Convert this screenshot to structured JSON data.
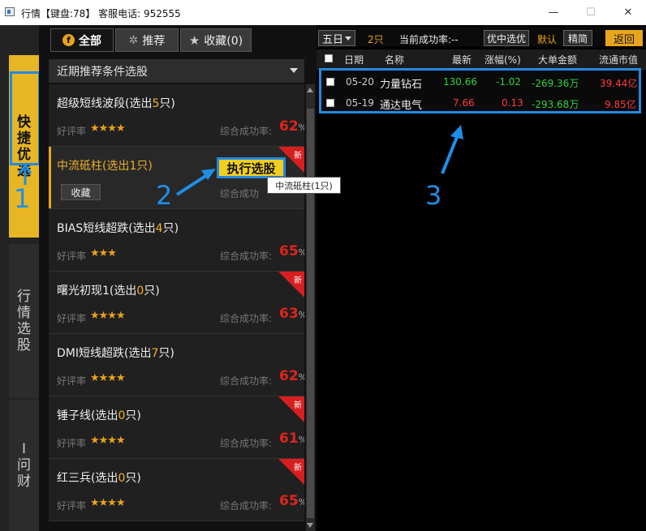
{
  "window": {
    "title": "行情【键盘:78】 客服电话: 952555",
    "min": "—",
    "max": "☐",
    "close": "✕"
  },
  "sidebar": {
    "tabs": [
      {
        "label": [
          "快",
          "捷",
          "优",
          "选"
        ],
        "active": true
      },
      {
        "label": [
          "行",
          "情",
          "选",
          "股"
        ],
        "active": false
      },
      {
        "label": [
          "I",
          "问",
          "财"
        ],
        "active": false
      }
    ]
  },
  "left": {
    "tabs": {
      "all": "全部",
      "recommend": "推荐",
      "favorites": "收藏(0)"
    },
    "section": "近期推荐条件选股",
    "rating_label": "好评率",
    "success_label": "综合成功率:",
    "fav_button": "收藏",
    "exec_button": "执行选股",
    "tooltip": "中流砥柱(1只)",
    "new_badge": "新",
    "cards": [
      {
        "name": "超级短线波段(选出",
        "count": "5",
        "suffix": "只)",
        "stars": "★★★★",
        "rate": "62",
        "new": false
      },
      {
        "name": "中流砥柱(选出",
        "count": "1",
        "suffix": "只)",
        "stars": "",
        "rate": "",
        "new": true
      },
      {
        "name": "BIAS短线超跌(选出",
        "count": "4",
        "suffix": "只)",
        "stars": "★★★",
        "rate": "65",
        "new": false
      },
      {
        "name": "曙光初现1(选出",
        "count": "0",
        "suffix": "只)",
        "stars": "★★★★",
        "rate": "63",
        "new": true
      },
      {
        "name": "DMI短线超跌(选出",
        "count": "7",
        "suffix": "只)",
        "stars": "★★★★",
        "rate": "62",
        "new": false
      },
      {
        "name": "锤子线(选出",
        "count": "0",
        "suffix": "只)",
        "stars": "★★★★",
        "rate": "61",
        "new": true
      },
      {
        "name": "红三兵(选出",
        "count": "0",
        "suffix": "只)",
        "stars": "★★★★",
        "rate": "65",
        "new": true
      }
    ],
    "pct": "%",
    "success_partial": "综合成功"
  },
  "right": {
    "period": "五日",
    "count": "2只",
    "rate_label": "当前成功率:--",
    "optimize_button": "优中选优",
    "default_label": "默认",
    "simple_button": "精简",
    "back_button": "返回",
    "columns": [
      "日期",
      "名称",
      "最新",
      "涨幅(%)",
      "大单金额",
      "流通市值"
    ],
    "rows": [
      {
        "date": "05-20",
        "name": "力量钻石",
        "price": "130.66",
        "change": "-1.02",
        "big": "-269.36万",
        "cap": "39.44亿"
      },
      {
        "date": "05-19",
        "name": "通达电气",
        "price": "7.66",
        "change": "0.13",
        "big": "-293.68万",
        "cap": "9.85亿"
      }
    ],
    "colors": {
      "up": "#ff3b3b",
      "down": "#2fd13c",
      "accent": "#e8a51c"
    }
  },
  "annotations": {
    "one": "1",
    "two": "2",
    "three": "3"
  }
}
